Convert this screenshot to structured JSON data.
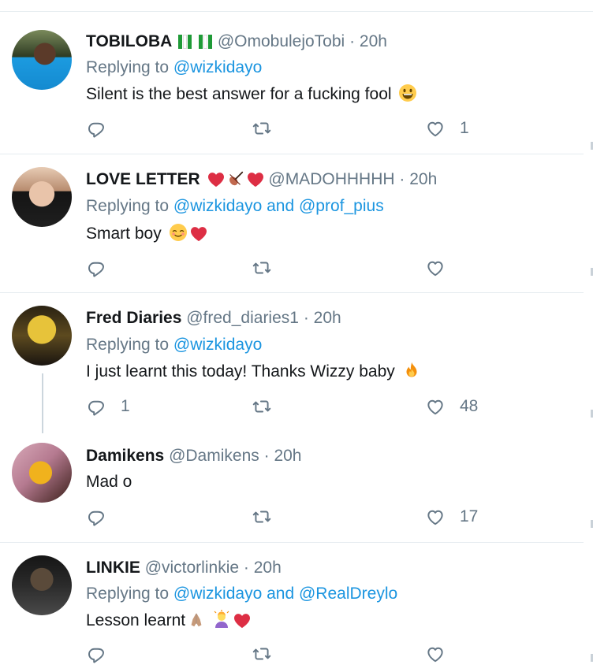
{
  "tweets": [
    {
      "name": "TOBILOBA",
      "handle": "@OmobulejoTobi",
      "time": "20h",
      "replying_prefix": "Replying to ",
      "replying_to": [
        "@wizkidayo"
      ],
      "text": "Silent is the best answer for a fucking fool",
      "emojis_after_name": [
        "nigeria-flag",
        "nigeria-flag"
      ],
      "emojis_after_text": [
        "grinning-face"
      ],
      "reply_count": "",
      "like_count": "1"
    },
    {
      "name": "LOVE LETTER",
      "handle": "@MADOHHHHH",
      "time": "20h",
      "replying_prefix": "Replying to ",
      "replying_to": [
        "@wizkidayo",
        "@prof_pius"
      ],
      "replying_joiner": " and ",
      "text": "Smart boy",
      "emojis_after_name": [
        "red-heart",
        "violin",
        "red-heart"
      ],
      "emojis_after_text": [
        "relieved-face",
        "red-heart"
      ],
      "reply_count": "",
      "like_count": ""
    },
    {
      "name": "Fred Diaries",
      "handle": "@fred_diaries1",
      "time": "20h",
      "replying_prefix": "Replying to ",
      "replying_to": [
        "@wizkidayo"
      ],
      "text": "I just learnt this today! Thanks Wizzy baby",
      "emojis_after_text": [
        "fire"
      ],
      "reply_count": "1",
      "like_count": "48"
    },
    {
      "name": "Damikens",
      "handle": "@Damikens",
      "time": "20h",
      "text": "Mad o",
      "reply_count": "",
      "like_count": "17"
    },
    {
      "name": "LINKIE",
      "handle": "@victorlinkie",
      "time": "20h",
      "replying_prefix": "Replying to ",
      "replying_to": [
        "@wizkidayo",
        "@RealDreylo"
      ],
      "replying_joiner": " and ",
      "text": "Lesson learnt",
      "emojis_after_text": [
        "folded-hands",
        "person-gesturing",
        "red-heart"
      ],
      "reply_count": "",
      "like_count": ""
    }
  ],
  "dot": "·",
  "colors": {
    "link": "#1b95e0",
    "muted": "#657786",
    "text": "#14171a",
    "divider": "#e6ecf0"
  }
}
